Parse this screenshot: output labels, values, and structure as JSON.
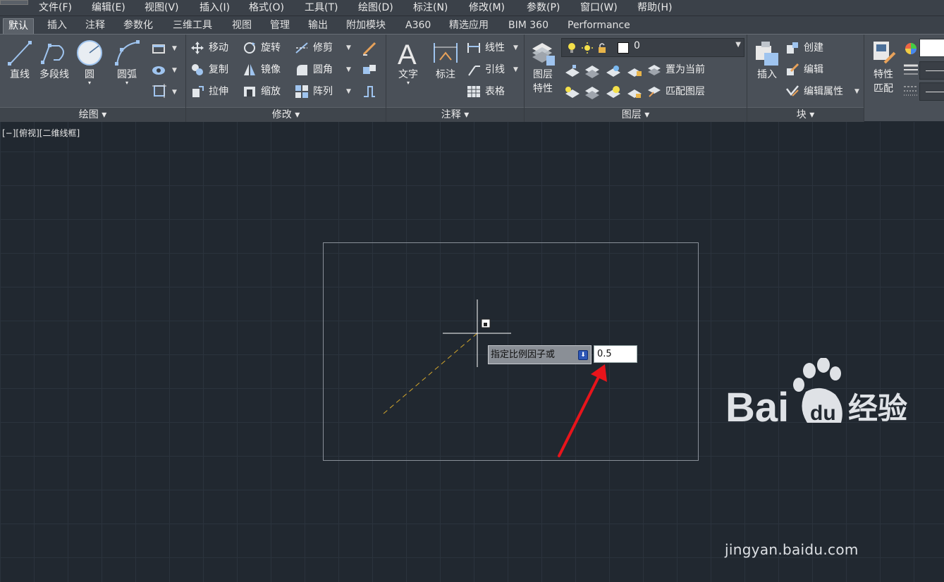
{
  "menubar": {
    "items": [
      "文件(F)",
      "编辑(E)",
      "视图(V)",
      "插入(I)",
      "格式(O)",
      "工具(T)",
      "绘图(D)",
      "标注(N)",
      "修改(M)",
      "参数(P)",
      "窗口(W)",
      "帮助(H)"
    ]
  },
  "tabs": [
    "默认",
    "插入",
    "注释",
    "参数化",
    "三维工具",
    "视图",
    "管理",
    "输出",
    "附加模块",
    "A360",
    "精选应用",
    "BIM 360",
    "Performance"
  ],
  "panels": {
    "draw": {
      "title": "绘图",
      "line": "直线",
      "polyline": "多段线",
      "circle": "圆",
      "arc": "圆弧"
    },
    "modify": {
      "title": "修改",
      "move": "移动",
      "rotate": "旋转",
      "trim": "修剪",
      "copy": "复制",
      "mirror": "镜像",
      "fillet": "圆角",
      "stretch": "拉伸",
      "scale": "缩放",
      "array": "阵列"
    },
    "annotation": {
      "title": "注释",
      "text": "文字",
      "dimension": "标注",
      "linear": "线性",
      "leader": "引线",
      "table": "表格"
    },
    "layers": {
      "title": "图层",
      "properties_line1": "图层",
      "properties_line2": "特性",
      "current_layer": "0",
      "set_current": "置为当前",
      "match_layer": "匹配图层"
    },
    "block": {
      "title": "块",
      "insert": "插入",
      "create": "创建",
      "edit": "编辑",
      "edit_attributes": "编辑属性"
    },
    "properties": {
      "match_line1": "特性",
      "match_line2": "匹配"
    }
  },
  "viewport": {
    "label": "[−][俯视][二维线框]"
  },
  "dynamic_input": {
    "prompt": "指定比例因子或",
    "value": "0.5"
  },
  "watermark": {
    "text": "jingyan.baidu.com"
  },
  "colors": {
    "annotation_arrow": "#e8141b",
    "dashed_line": "#d4a72c",
    "viewport_bg": "#212830"
  }
}
